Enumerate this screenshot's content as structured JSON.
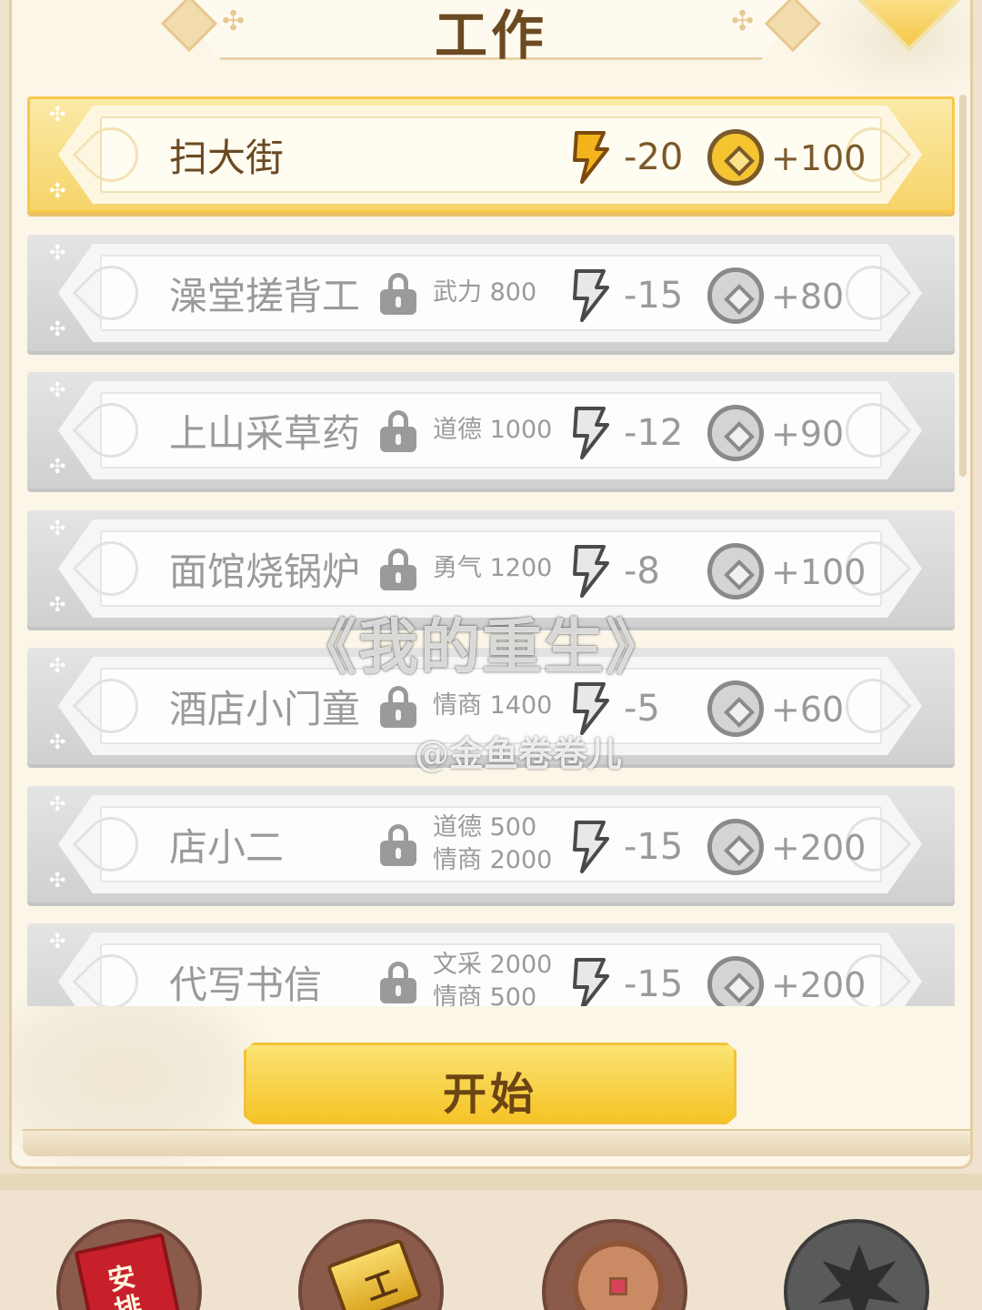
{
  "header": {
    "title": "工作"
  },
  "jobs": [
    {
      "name": "扫大街",
      "locked": false,
      "req1": "",
      "req2": "",
      "energy": "-20",
      "reward": "+100",
      "active": true
    },
    {
      "name": "澡堂搓背工",
      "locked": true,
      "req1": "武力 800",
      "req2": "",
      "energy": "-15",
      "reward": "+80",
      "active": false
    },
    {
      "name": "上山采草药",
      "locked": true,
      "req1": "道德 1000",
      "req2": "",
      "energy": "-12",
      "reward": "+90",
      "active": false
    },
    {
      "name": "面馆烧锅炉",
      "locked": true,
      "req1": "勇气 1200",
      "req2": "",
      "energy": "-8",
      "reward": "+100",
      "active": false
    },
    {
      "name": "酒店小门童",
      "locked": true,
      "req1": "情商 1400",
      "req2": "",
      "energy": "-5",
      "reward": "+60",
      "active": false
    },
    {
      "name": "店小二",
      "locked": true,
      "req1": "道德 500",
      "req2": "情商 2000",
      "energy": "-15",
      "reward": "+200",
      "active": false
    },
    {
      "name": "代写书信",
      "locked": true,
      "req1": "文采 2000",
      "req2": "情商 500",
      "energy": "-15",
      "reward": "+200",
      "active": false
    }
  ],
  "watermark": {
    "line1": "《我的重生》",
    "line2": "@金鱼卷卷儿"
  },
  "actions": {
    "start_label": "开始"
  },
  "tabs": [
    {
      "icon": "red-book-icon",
      "text": "安排"
    },
    {
      "icon": "gold-hammer-icon",
      "text": "工"
    },
    {
      "icon": "copper-coins-icon",
      "text": ""
    },
    {
      "icon": "dark-leaf-icon",
      "text": ""
    }
  ],
  "colors": {
    "accent_gold": "#f5c427",
    "active_row": "#f6d46a",
    "locked_gray": "#9a9a9a",
    "text_brown": "#6b4a22"
  }
}
